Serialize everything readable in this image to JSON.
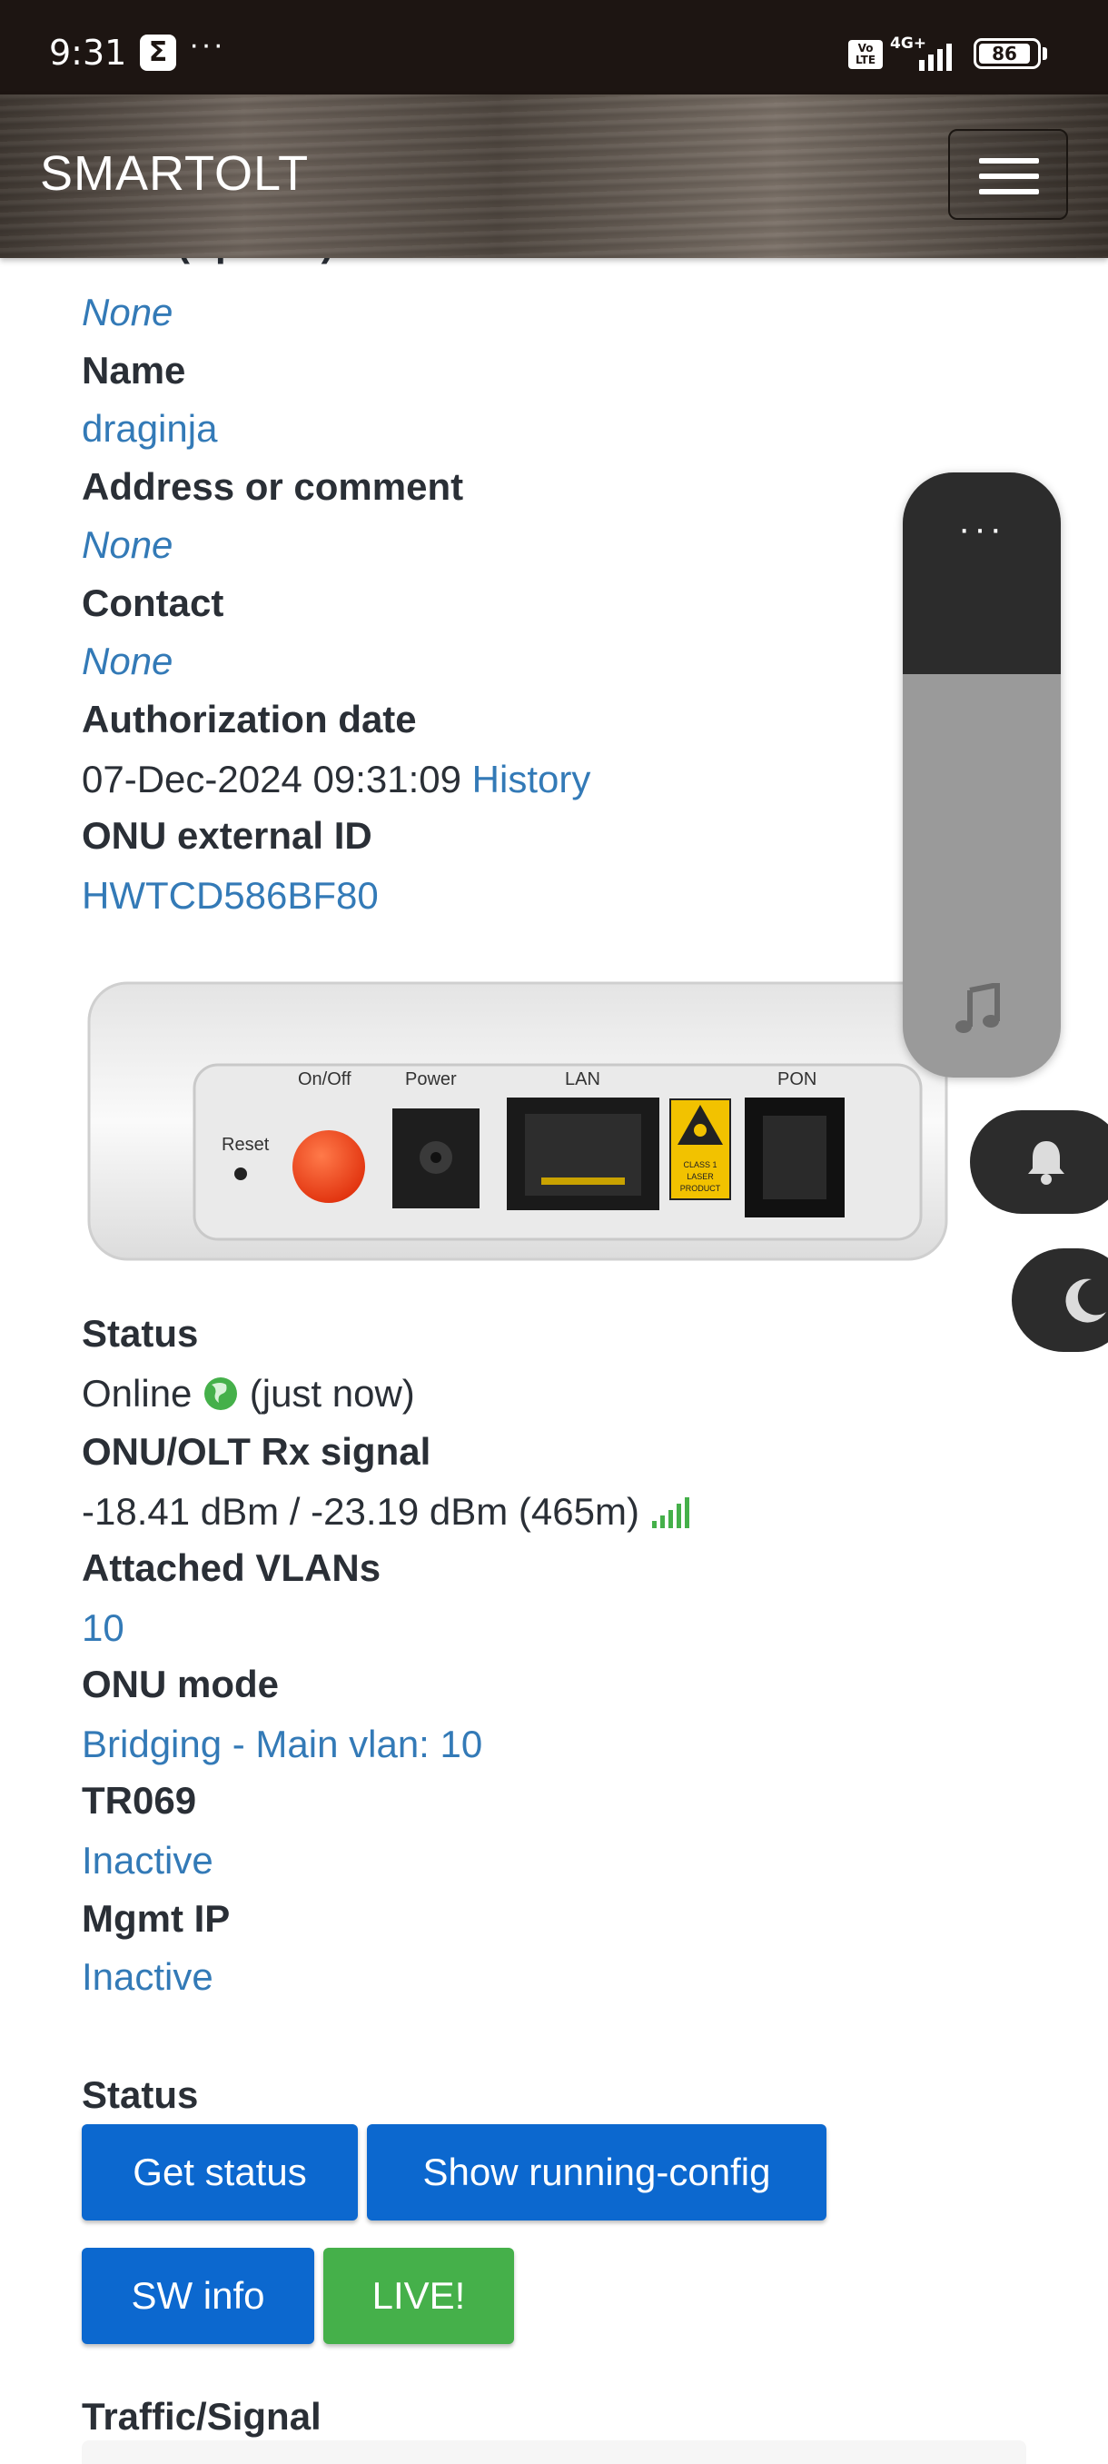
{
  "status_bar": {
    "time": "9:31",
    "notification_icon": "sigma",
    "more": "···",
    "volte": "Vo LTE",
    "network": "4G+",
    "battery": "86"
  },
  "navbar": {
    "brand": "SMARTOLT",
    "menu_icon": "hamburger-icon"
  },
  "details": {
    "odb_label": "ODB (Splitter)",
    "odb_value": "None",
    "name_label": "Name",
    "name_value": "draginja",
    "address_label": "Address or comment",
    "address_value": "None",
    "contact_label": "Contact",
    "contact_value": "None",
    "auth_date_label": "Authorization date",
    "auth_date_value": "07-Dec-2024 09:31:09",
    "auth_history_link": "History",
    "external_id_label": "ONU external ID",
    "external_id_value": "HWTCD586BF80"
  },
  "device_image": {
    "reset": "Reset",
    "onoff": "On/Off",
    "power": "Power",
    "lan": "LAN",
    "pon": "PON",
    "laser_label": "CLASS 1 LASER PRODUCT"
  },
  "status_info": {
    "status_label": "Status",
    "status_online": "Online",
    "status_time": "(just now)",
    "signal_label": "ONU/OLT Rx signal",
    "signal_value": "-18.41 dBm / -23.19 dBm (465m)",
    "vlans_label": "Attached VLANs",
    "vlans_value": "10",
    "mode_label": "ONU mode",
    "mode_value": "Bridging - Main vlan: 10",
    "tr069_label": "TR069",
    "tr069_value": "Inactive",
    "mgmt_label": "Mgmt IP",
    "mgmt_value": "Inactive"
  },
  "actions": {
    "section_label": "Status",
    "get_status": "Get status",
    "show_running_config": "Show running-config",
    "sw_info": "SW info",
    "live": "LIVE!"
  },
  "traffic": {
    "section_label": "Traffic/Signal"
  },
  "floating": {
    "panel_more": "···",
    "music_icon": "music-note-icon",
    "bell_icon": "bell-icon",
    "moon_icon": "moon-icon"
  },
  "colors": {
    "link": "#337ab7",
    "primary_button": "#0c68cf",
    "success_button": "#45b04a",
    "signal_good": "#45b04a"
  }
}
